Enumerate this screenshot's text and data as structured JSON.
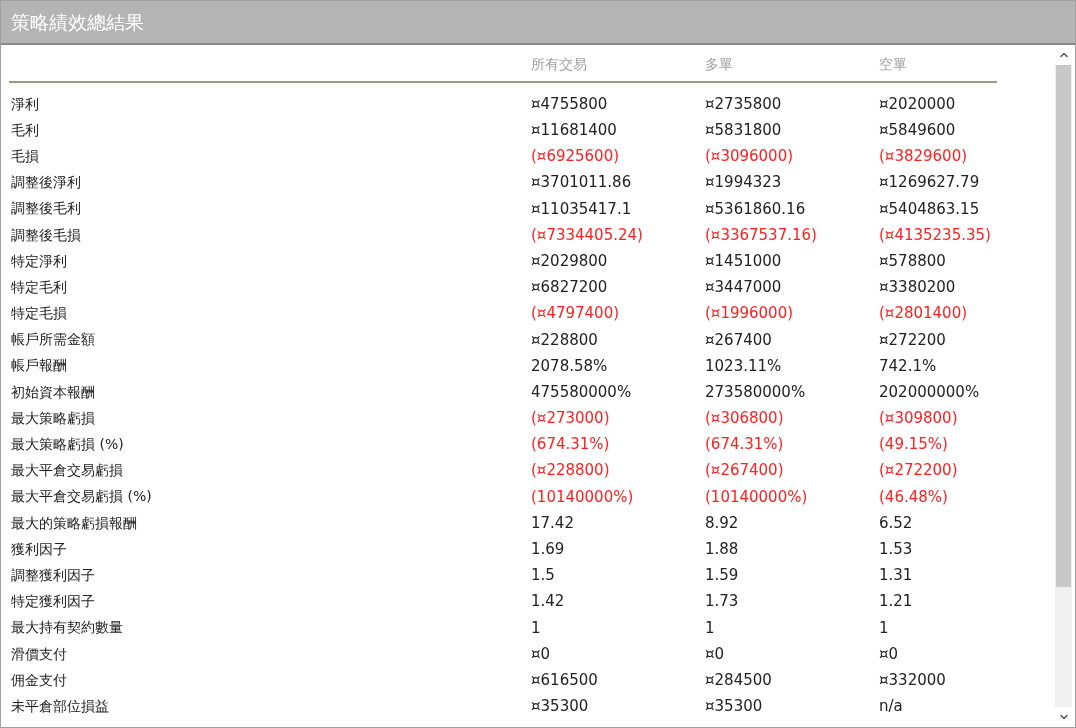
{
  "title": "策略績效總結果",
  "columns": [
    "所有交易",
    "多單",
    "空單"
  ],
  "rows": [
    {
      "label": "淨利",
      "negative": false,
      "values": [
        "¤4755800",
        "¤2735800",
        "¤2020000"
      ]
    },
    {
      "label": "毛利",
      "negative": false,
      "values": [
        "¤11681400",
        "¤5831800",
        "¤5849600"
      ]
    },
    {
      "label": "毛損",
      "negative": true,
      "values": [
        "(¤6925600)",
        "(¤3096000)",
        "(¤3829600)"
      ]
    },
    {
      "label": "調整後淨利",
      "negative": false,
      "values": [
        "¤3701011.86",
        "¤1994323",
        "¤1269627.79"
      ]
    },
    {
      "label": "調整後毛利",
      "negative": false,
      "values": [
        "¤11035417.1",
        "¤5361860.16",
        "¤5404863.15"
      ]
    },
    {
      "label": "調整後毛損",
      "negative": true,
      "values": [
        "(¤7334405.24)",
        "(¤3367537.16)",
        "(¤4135235.35)"
      ]
    },
    {
      "label": "特定淨利",
      "negative": false,
      "values": [
        "¤2029800",
        "¤1451000",
        "¤578800"
      ]
    },
    {
      "label": "特定毛利",
      "negative": false,
      "values": [
        "¤6827200",
        "¤3447000",
        "¤3380200"
      ]
    },
    {
      "label": "特定毛損",
      "negative": true,
      "values": [
        "(¤4797400)",
        "(¤1996000)",
        "(¤2801400)"
      ]
    },
    {
      "label": "帳戶所需金額",
      "negative": false,
      "values": [
        "¤228800",
        "¤267400",
        "¤272200"
      ]
    },
    {
      "label": "帳戶報酬",
      "negative": false,
      "values": [
        "2078.58%",
        "1023.11%",
        "742.1%"
      ]
    },
    {
      "label": "初始資本報酬",
      "negative": false,
      "values": [
        "475580000%",
        "273580000%",
        "202000000%"
      ]
    },
    {
      "label": "最大策略虧損",
      "negative": true,
      "values": [
        "(¤273000)",
        "(¤306800)",
        "(¤309800)"
      ]
    },
    {
      "label": "最大策略虧損 (%)",
      "negative": true,
      "values": [
        "(674.31%)",
        "(674.31%)",
        "(49.15%)"
      ]
    },
    {
      "label": "最大平倉交易虧損",
      "negative": true,
      "values": [
        "(¤228800)",
        "(¤267400)",
        "(¤272200)"
      ]
    },
    {
      "label": "最大平倉交易虧損 (%)",
      "negative": true,
      "values": [
        "(10140000%)",
        "(10140000%)",
        "(46.48%)"
      ]
    },
    {
      "label": "最大的策略虧損報酬",
      "negative": false,
      "values": [
        "17.42",
        "8.92",
        "6.52"
      ]
    },
    {
      "label": "獲利因子",
      "negative": false,
      "values": [
        "1.69",
        "1.88",
        "1.53"
      ]
    },
    {
      "label": "調整獲利因子",
      "negative": false,
      "values": [
        "1.5",
        "1.59",
        "1.31"
      ]
    },
    {
      "label": "特定獲利因子",
      "negative": false,
      "values": [
        "1.42",
        "1.73",
        "1.21"
      ]
    },
    {
      "label": "最大持有契約數量",
      "negative": false,
      "values": [
        "1",
        "1",
        "1"
      ]
    },
    {
      "label": "滑價支付",
      "negative": false,
      "values": [
        "¤0",
        "¤0",
        "¤0"
      ]
    },
    {
      "label": "佣金支付",
      "negative": false,
      "values": [
        "¤616500",
        "¤284500",
        "¤332000"
      ]
    },
    {
      "label": "未平倉部位損益",
      "negative": false,
      "values": [
        "¤35300",
        "¤35300",
        "n/a"
      ]
    }
  ]
}
